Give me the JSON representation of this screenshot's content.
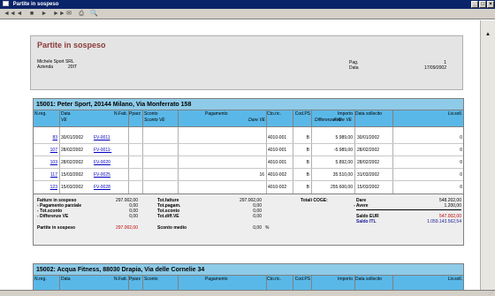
{
  "window": {
    "title": "Partite in sospeso",
    "buttons": [
      "_",
      "□",
      "×"
    ]
  },
  "toolbar": {
    "icons": [
      "◄◄",
      "◄",
      "■",
      "►",
      "►►",
      "✉",
      "⎙",
      "🔍"
    ]
  },
  "report": {
    "title": "Partite in sospeso",
    "company": "Michele Sport SRL",
    "azienda_label": "Azienda",
    "azienda_value": "20IT",
    "pag_label": "Pag.",
    "pag_value": "1",
    "data_label": "Data",
    "data_value": "17/09/2002"
  },
  "columns": {
    "nreg": "N.reg.",
    "data": "Data",
    "data_sub": "VE",
    "nfatt": "N.Fatt.",
    "pparz": "Pparz",
    "sconto": "Sconto",
    "sconto_sub": "Sconto VE",
    "pagamento": "Pagamento",
    "dare_ve": "Dare VE",
    "ctoric": "Cto.ric.",
    "codps": "Cod.PS",
    "avere_ve": "Avere VE",
    "importo": "Importo",
    "diff_ve": "Differenza VE",
    "data_sollecito": "Data sollecito",
    "liv_soll": "Liv.soll."
  },
  "sections": [
    {
      "heading": "15001:  Peter Sport, 20144  Milano, Via Monferrato 158",
      "rows": [
        {
          "nreg": "83",
          "data": "30/01/2002",
          "nfatt": "FV-0011",
          "pagamento": "",
          "cto": "4010-001",
          "codps": "B",
          "importo": "5.989,00",
          "dsoll": "30/01/2002",
          "liv": "0"
        },
        {
          "nreg": "107",
          "data": "28/02/2002",
          "nfatt": "FV-0011-",
          "pagamento": "",
          "cto": "4010-001",
          "codps": "B",
          "importo": "-5.989,00",
          "dsoll": "28/02/2002",
          "liv": "0"
        },
        {
          "nreg": "103",
          "data": "28/02/2002",
          "nfatt": "FV-0020",
          "pagamento": "",
          "cto": "4010-001",
          "codps": "B",
          "importo": "5.892,00",
          "dsoll": "28/02/2002",
          "liv": "0"
        },
        {
          "nreg": "117",
          "data": "15/03/2002",
          "nfatt": "FV-0025",
          "pagamento": "16",
          "cto": "4010-002",
          "codps": "B",
          "importo": "35.510,00",
          "dsoll": "31/03/2002",
          "liv": "0"
        },
        {
          "nreg": "123",
          "data": "15/03/2002",
          "nfatt": "FV-0028",
          "pagamento": "",
          "cto": "4010-002",
          "codps": "B",
          "importo": "255.600,00",
          "dsoll": "15/03/2002",
          "liv": "0"
        }
      ],
      "totals": {
        "fatture_label": "Fatture in sospeso",
        "fatture_value": "297.002,00",
        "pag_parz_label": "- Pagamento parziale",
        "pag_parz_value": "0,00",
        "tot_sconto_label": "- Tot.sconto",
        "tot_sconto_value": "0,00",
        "diff_ve_label": "- Differenze VE",
        "diff_ve_value": "0,00",
        "partite_label": "Partite in sospeso",
        "partite_value": "297.002,00",
        "totfatture_label": "Tot.fatture",
        "totfatture_value": "297.002,00",
        "totpagam_label": "Tot.pagam.",
        "totpagam_value": "0,00",
        "totsconto_label": "Tot.sconto",
        "totsconto_value": "0,00",
        "totdiff_label": "Tot.diff.VE",
        "totdiff_value": "0,00",
        "sconto_medio_label": "Sconto medio",
        "sconto_medio_value": "0,00",
        "sconto_medio_unit": "%",
        "coge_label": "Totali COGE:",
        "dare_label": "Dare",
        "dare_value": "548.202,00",
        "avere_label": "- Avere",
        "avere_value": "1.200,00",
        "saldo_eur_label": "Saldo EUR",
        "saldo_eur_value": "547.002,00",
        "saldo_itl_label": "Saldo ITL",
        "saldo_itl_value": "1.059.143.562,54"
      }
    },
    {
      "heading": "15002:  Acqua Fitness, 88030  Drapia, Via delle Cornelie 34"
    }
  ]
}
